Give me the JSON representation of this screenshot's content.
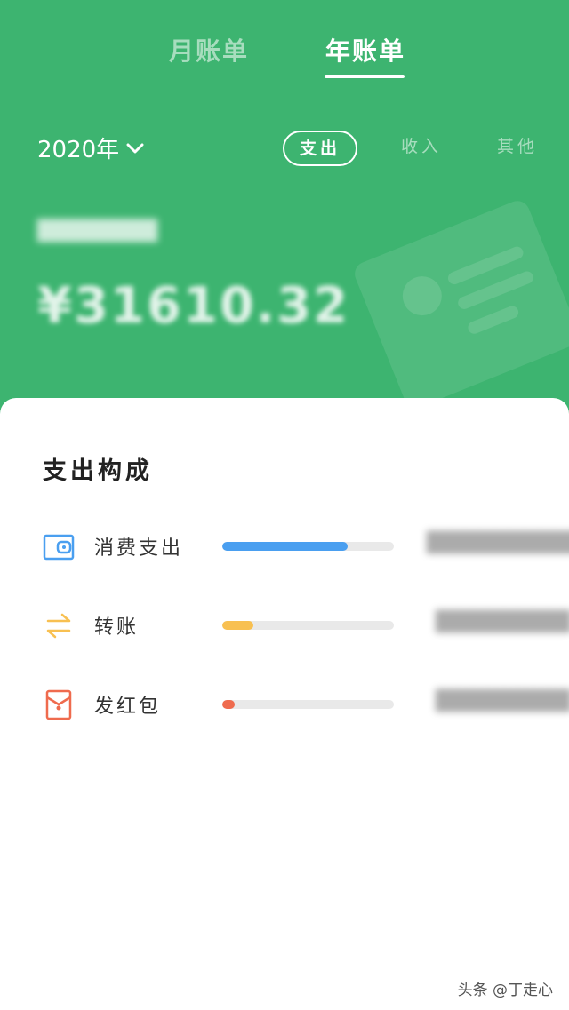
{
  "tabs": {
    "month": "月账单",
    "year": "年账单"
  },
  "year_select": {
    "label": "2020年",
    "icon": "chevron-down-icon"
  },
  "type_tabs": {
    "expense": "支出",
    "income": "收入",
    "other": "其他"
  },
  "summary": {
    "label": "████████",
    "amount": "¥31610.32"
  },
  "section": {
    "title": "支出构成"
  },
  "breakdown": [
    {
      "label": "消费支出",
      "icon": "wallet-icon",
      "color": "#4a9ff0",
      "fraction": 0.73,
      "value": "██████████"
    },
    {
      "label": "转账",
      "icon": "transfer-icon",
      "color": "#f8c051",
      "fraction": 0.18,
      "value": "█████████"
    },
    {
      "label": "发红包",
      "icon": "red-envelope-icon",
      "color": "#ef6b4e",
      "fraction": 0.07,
      "value": "█████████"
    }
  ],
  "colors": {
    "header": "#3db470",
    "panel": "#ffffff"
  },
  "watermark": "头条 @丁走心"
}
